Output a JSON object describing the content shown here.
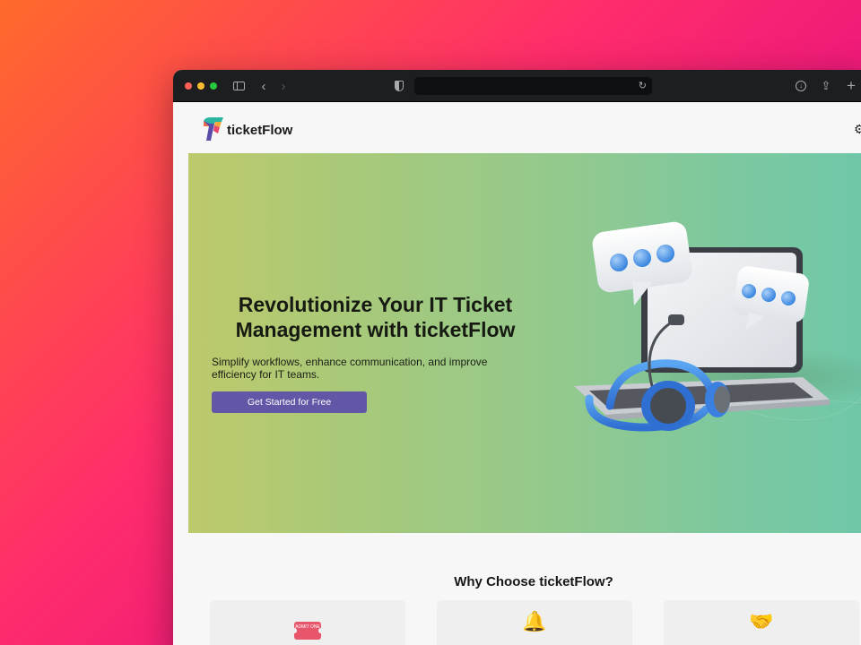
{
  "browser": {
    "back_icon": "chevron-left-icon",
    "forward_icon": "chevron-right-icon",
    "reload_glyph": "↻",
    "download_glyph": "↓",
    "share_glyph": "⇪",
    "newtab_glyph": "+"
  },
  "nav": {
    "brand": "ticketFlow",
    "settings_glyph": "⚙"
  },
  "hero": {
    "title": "Revolutionize Your IT Ticket Management with ticketFlow",
    "subtitle": "Simplify workflows, enhance communication, and improve efficiency for IT teams.",
    "cta_label": "Get Started for Free"
  },
  "features": {
    "title": "Why Choose ticketFlow?",
    "cards": [
      {
        "icon": "ticket-icon",
        "ticket_text": "ADMIT ONE"
      },
      {
        "icon": "bell-icon",
        "glyph": "🔔"
      },
      {
        "icon": "handshake-icon",
        "glyph": "🤝"
      }
    ]
  },
  "colors": {
    "accent": "#6256a6",
    "hero_start": "#bdc96b",
    "hero_end": "#6ec7a8",
    "titlebar": "#1d1e20"
  }
}
